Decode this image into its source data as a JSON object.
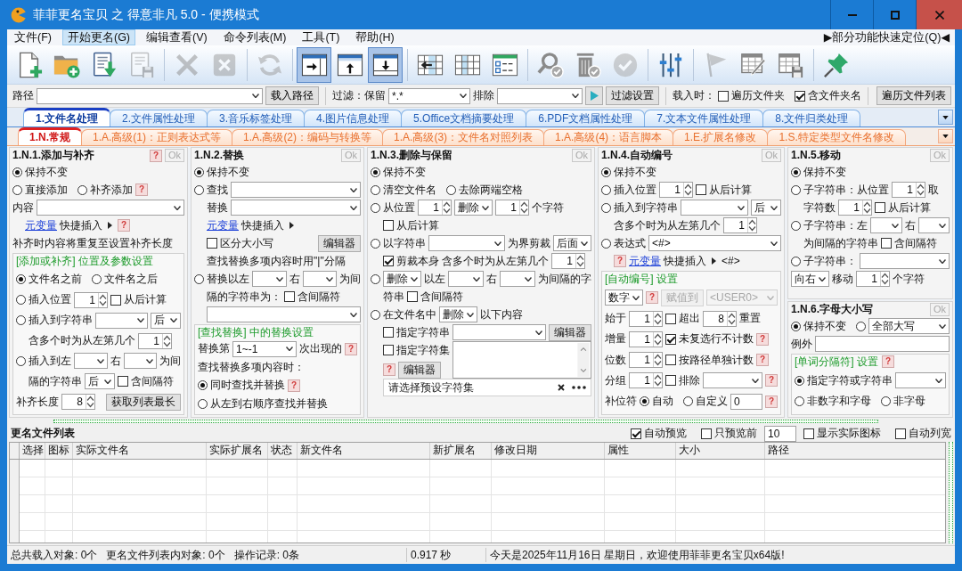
{
  "window": {
    "title": "菲菲更名宝贝 之 得意非凡 5.0 - 便携模式"
  },
  "menu": {
    "items": [
      {
        "label": "文件(F)",
        "selected": false
      },
      {
        "label": "开始更名(G)",
        "selected": true
      },
      {
        "label": "编辑查看(V)",
        "selected": false
      },
      {
        "label": "命令列表(M)",
        "selected": false
      },
      {
        "label": "工具(T)",
        "selected": false
      },
      {
        "label": "帮助(H)",
        "selected": false
      }
    ],
    "quick_locate": "▶部分功能快速定位(Q)◀"
  },
  "toolbar": {
    "groups": [
      [
        {
          "kind": "newfile",
          "disabled": false
        },
        {
          "kind": "addfolder",
          "disabled": false
        },
        {
          "kind": "import",
          "disabled": false
        },
        {
          "kind": "save",
          "disabled": true
        }
      ],
      [
        {
          "kind": "delete",
          "disabled": true
        },
        {
          "kind": "remove",
          "disabled": true
        }
      ],
      [
        {
          "kind": "refresh",
          "disabled": true
        }
      ],
      [
        {
          "kind": "viewright",
          "disabled": false,
          "selected": true
        },
        {
          "kind": "viewup",
          "disabled": false,
          "selected": false
        },
        {
          "kind": "viewdown",
          "disabled": false,
          "selected": true
        }
      ],
      [
        {
          "kind": "gridleft",
          "disabled": false
        },
        {
          "kind": "grid",
          "disabled": false
        },
        {
          "kind": "checklist",
          "disabled": false
        }
      ],
      [
        {
          "kind": "searchcheck",
          "disabled": false
        },
        {
          "kind": "trashcheck",
          "disabled": false
        },
        {
          "kind": "checkcircle",
          "disabled": true
        }
      ],
      [
        {
          "kind": "sliders",
          "disabled": false
        }
      ],
      [
        {
          "kind": "flag",
          "disabled": true
        },
        {
          "kind": "tableedit",
          "disabled": false
        },
        {
          "kind": "tablesave",
          "disabled": false
        }
      ],
      [
        {
          "kind": "pin",
          "disabled": false
        }
      ]
    ]
  },
  "path_bar": {
    "label": "路径",
    "load_button": "载入路径",
    "filter_label": "过滤：保留",
    "keep": "*.*",
    "exclude_label": "排除",
    "settings_button": "过滤设置",
    "on_load_label": "载入时：",
    "options": [
      {
        "label": "遍历文件夹",
        "checked": false
      },
      {
        "label": "含文件夹名",
        "checked": true
      }
    ],
    "list_button": "遍历文件列表"
  },
  "tabs": [
    {
      "label": "1.文件名处理",
      "selected": true
    },
    {
      "label": "2.文件属性处理",
      "selected": false
    },
    {
      "label": "3.音乐标签处理",
      "selected": false
    },
    {
      "label": "4.图片信息处理",
      "selected": false
    },
    {
      "label": "5.Office文档摘要处理",
      "selected": false
    },
    {
      "label": "6.PDF文档属性处理",
      "selected": false
    },
    {
      "label": "7.文本文件属性处理",
      "selected": false
    },
    {
      "label": "8.文件归类处理",
      "selected": false
    }
  ],
  "subtabs": [
    {
      "label": "1.N.常规",
      "selected": true
    },
    {
      "label": "1.A.高级(1)：正则表达式等",
      "selected": false
    },
    {
      "label": "1.A.高级(2)：编码与转换等",
      "selected": false
    },
    {
      "label": "1.A.高级(3)：文件名对照列表",
      "selected": false
    },
    {
      "label": "1.A.高级(4)：语言脚本",
      "selected": false
    },
    {
      "label": "1.E.扩展名修改",
      "selected": false
    },
    {
      "label": "1.S.特定类型文件名修改",
      "selected": false
    }
  ],
  "panels": [
    {
      "sections": [
        {
          "title": "1.N.1.添加与补齐",
          "help": "?",
          "ok": {
            "label": "Ok",
            "disabled": true
          },
          "rows": [
            {
              "kind": "row",
              "items": [
                {
                  "kind": "radio",
                  "label": "保持不变",
                  "selected": true
                }
              ]
            },
            {
              "kind": "row",
              "items": [
                {
                  "kind": "radio",
                  "label": "直接添加",
                  "selected": false
                },
                {
                  "kind": "radio",
                  "label": "补齐添加",
                  "selected": false
                },
                {
                  "kind": "help",
                  "label": "?"
                }
              ]
            },
            {
              "kind": "row",
              "items": [
                {
                  "kind": "text",
                  "text": "内容"
                },
                {
                  "kind": "combo",
                  "disabled": false
                }
              ],
              "children": [
                {
                  "kind": "row",
                  "items": [
                    {
                      "kind": "link",
                      "label": "元变量"
                    },
                    {
                      "kind": "text",
                      "text": "快捷插入"
                    },
                    {
                      "kind": "arrow"
                    },
                    {
                      "kind": "help",
                      "label": "?"
                    }
                  ]
                }
              ]
            },
            {
              "kind": "row",
              "items": [
                {
                  "kind": "text",
                  "text": "补齐时内容将重复至设置补齐长度"
                }
              ]
            },
            {
              "kind": "group",
              "title": "[添加或补齐] 位置及参数设置",
              "rows": [
                {
                  "kind": "row",
                  "items": [
                    {
                      "kind": "radio",
                      "label": "文件名之前",
                      "selected": true
                    },
                    {
                      "kind": "radio",
                      "label": "文件名之后",
                      "selected": false
                    }
                  ]
                },
                {
                  "kind": "row",
                  "items": [
                    {
                      "kind": "radio",
                      "label": "插入位置",
                      "selected": false
                    },
                    {
                      "kind": "spin",
                      "value": "1"
                    },
                    {
                      "kind": "check",
                      "label": "从后计算",
                      "checked": false
                    }
                  ]
                },
                {
                  "kind": "row",
                  "items": [
                    {
                      "kind": "radio",
                      "label": "插入到字符串",
                      "selected": false
                    },
                    {
                      "kind": "combo",
                      "disabled": false
                    },
                    {
                      "kind": "choice",
                      "value": "后",
                      "disabled": false
                    }
                  ],
                  "children": [
                    {
                      "kind": "row",
                      "items": [
                        {
                          "kind": "text",
                          "text": "含多个时为从左第几个"
                        },
                        {
                          "kind": "spin",
                          "value": "1"
                        }
                      ]
                    }
                  ]
                },
                {
                  "kind": "row",
                  "items": [
                    {
                      "kind": "radio",
                      "label": "插入到左",
                      "selected": false
                    },
                    {
                      "kind": "combo",
                      "disabled": false
                    },
                    {
                      "kind": "text",
                      "text": "右"
                    },
                    {
                      "kind": "combo",
                      "disabled": false
                    },
                    {
                      "kind": "text",
                      "text": "为间"
                    }
                  ],
                  "children": [
                    {
                      "kind": "row",
                      "items": [
                        {
                          "kind": "text",
                          "text": "隔的字符串"
                        },
                        {
                          "kind": "choice",
                          "value": "后",
                          "disabled": false
                        },
                        {
                          "kind": "check",
                          "label": "含间隔符",
                          "checked": false
                        }
                      ]
                    }
                  ]
                },
                {
                  "kind": "row",
                  "items": [
                    {
                      "kind": "text",
                      "text": "补齐长度"
                    },
                    {
                      "kind": "spin",
                      "value": "8"
                    },
                    {
                      "kind": "button",
                      "label": "获取列表最长",
                      "disabled": false
                    }
                  ]
                }
              ]
            }
          ]
        }
      ]
    },
    {
      "sections": [
        {
          "title": "1.N.2.替换",
          "ok": {
            "label": "Ok",
            "disabled": true
          },
          "rows": [
            {
              "kind": "row",
              "items": [
                {
                  "kind": "radio",
                  "label": "保持不变",
                  "selected": true
                }
              ]
            },
            {
              "kind": "row",
              "items": [
                {
                  "kind": "radio",
                  "label": "查找",
                  "selected": false
                },
                {
                  "kind": "combo",
                  "disabled": false
                }
              ],
              "children": [
                {
                  "kind": "row",
                  "items": [
                    {
                      "kind": "text",
                      "text": "替换"
                    },
                    {
                      "kind": "combo",
                      "disabled": false
                    }
                  ]
                },
                {
                  "kind": "row",
                  "items": [
                    {
                      "kind": "link",
                      "label": "元变量"
                    },
                    {
                      "kind": "text",
                      "text": "快捷插入"
                    },
                    {
                      "kind": "arrow"
                    }
                  ]
                },
                {
                  "kind": "row",
                  "items": [
                    {
                      "kind": "check",
                      "label": "区分大小写",
                      "checked": false
                    },
                    {
                      "kind": "button",
                      "label": "编辑器",
                      "disabled": false
                    }
                  ]
                },
                {
                  "kind": "row",
                  "items": [
                    {
                      "kind": "text",
                      "text": "查找替换多项内容时用\"|\"分隔"
                    }
                  ]
                }
              ]
            },
            {
              "kind": "row",
              "items": [
                {
                  "kind": "radio",
                  "label": "替换以左",
                  "selected": false
                },
                {
                  "kind": "combo",
                  "disabled": false
                },
                {
                  "kind": "text",
                  "text": "右"
                },
                {
                  "kind": "combo",
                  "disabled": false
                },
                {
                  "kind": "text",
                  "text": "为间"
                }
              ],
              "children": [
                {
                  "kind": "row",
                  "items": [
                    {
                      "kind": "text",
                      "text": "隔的字符串为："
                    },
                    {
                      "kind": "check",
                      "label": "含间隔符",
                      "checked": false
                    }
                  ]
                },
                {
                  "kind": "row",
                  "items": [
                    {
                      "kind": "combo",
                      "disabled": false
                    }
                  ]
                }
              ]
            },
            {
              "kind": "group",
              "title": "[查找替换] 中的替换设置",
              "rows": [
                {
                  "kind": "row",
                  "items": [
                    {
                      "kind": "text",
                      "text": "替换第"
                    },
                    {
                      "kind": "combo",
                      "value": "1~-1",
                      "disabled": false
                    },
                    {
                      "kind": "text",
                      "text": "次出现的"
                    },
                    {
                      "kind": "help",
                      "label": "?"
                    }
                  ]
                },
                {
                  "kind": "row",
                  "items": [
                    {
                      "kind": "text",
                      "text": "查找替换多项内容时："
                    }
                  ]
                },
                {
                  "kind": "row",
                  "items": [
                    {
                      "kind": "radio",
                      "label": "同时查找并替换",
                      "selected": true
                    },
                    {
                      "kind": "help",
                      "label": "?"
                    }
                  ]
                },
                {
                  "kind": "row",
                  "items": [
                    {
                      "kind": "radio",
                      "label": "从左到右顺序查找并替换",
                      "selected": false
                    }
                  ]
                }
              ]
            }
          ]
        }
      ]
    },
    {
      "sections": [
        {
          "title": "1.N.3.删除与保留",
          "ok": {
            "label": "Ok",
            "disabled": true
          },
          "rows": [
            {
              "kind": "row",
              "items": [
                {
                  "kind": "radio",
                  "label": "保持不变",
                  "selected": true
                }
              ]
            },
            {
              "kind": "row",
              "items": [
                {
                  "kind": "radio",
                  "label": "清空文件名",
                  "selected": false
                },
                {
                  "kind": "radio",
                  "label": "去除两端空格",
                  "selected": false
                }
              ]
            },
            {
              "kind": "row",
              "items": [
                {
                  "kind": "radio",
                  "label": "从位置",
                  "selected": false
                },
                {
                  "kind": "spin",
                  "value": "1"
                },
                {
                  "kind": "choice",
                  "value": "删除",
                  "disabled": false
                },
                {
                  "kind": "spin",
                  "value": "1"
                },
                {
                  "kind": "text",
                  "text": "个字符"
                }
              ],
              "children": [
                {
                  "kind": "row",
                  "items": [
                    {
                      "kind": "check",
                      "label": "从后计算",
                      "checked": false
                    }
                  ]
                }
              ]
            },
            {
              "kind": "row",
              "items": [
                {
                  "kind": "radio",
                  "label": "以字符串",
                  "selected": false
                },
                {
                  "kind": "combo",
                  "disabled": false
                },
                {
                  "kind": "text",
                  "text": "为界剪裁"
                },
                {
                  "kind": "choice",
                  "value": "后面",
                  "disabled": false
                }
              ],
              "children": [
                {
                  "kind": "row",
                  "items": [
                    {
                      "kind": "check",
                      "label": "剪裁本身",
                      "checked": true
                    },
                    {
                      "kind": "text",
                      "text": "含多个时为从左第几个"
                    },
                    {
                      "kind": "spin",
                      "value": "1"
                    }
                  ]
                }
              ]
            },
            {
              "kind": "row",
              "items": [
                {
                  "kind": "radio",
                  "selected": false
                },
                {
                  "kind": "choice",
                  "value": "删除",
                  "disabled": false
                },
                {
                  "kind": "text",
                  "text": "以左"
                },
                {
                  "kind": "combo",
                  "disabled": false
                },
                {
                  "kind": "text",
                  "text": "右"
                },
                {
                  "kind": "combo",
                  "disabled": false
                },
                {
                  "kind": "text",
                  "text": "为间隔的字"
                }
              ],
              "children": [
                {
                  "kind": "row",
                  "items": [
                    {
                      "kind": "text",
                      "text": "符串"
                    },
                    {
                      "kind": "check",
                      "label": "含间隔符",
                      "checked": false
                    }
                  ]
                }
              ]
            },
            {
              "kind": "row",
              "items": [
                {
                  "kind": "radio",
                  "label": "在文件名中",
                  "selected": false
                },
                {
                  "kind": "choice",
                  "value": "删除",
                  "disabled": false
                },
                {
                  "kind": "text",
                  "text": "以下内容"
                }
              ],
              "children": [
                {
                  "kind": "row",
                  "items": [
                    {
                      "kind": "check",
                      "label": "指定字符串",
                      "checked": false
                    },
                    {
                      "kind": "combo",
                      "disabled": false
                    },
                    {
                      "kind": "button",
                      "label": "编辑器",
                      "disabled": false
                    }
                  ]
                },
                {
                  "kind": "row",
                  "items": [
                    {
                      "kind": "stack",
                      "rows": [
                        {
                          "items": [
                            {
                              "kind": "check",
                              "label": "指定字符集",
                              "checked": false
                            }
                          ]
                        },
                        {
                          "items": [
                            {
                              "kind": "help",
                              "label": "?"
                            },
                            {
                              "kind": "button",
                              "label": "编辑器",
                              "disabled": false
                            }
                          ]
                        }
                      ]
                    },
                    {
                      "kind": "memo"
                    }
                  ]
                },
                {
                  "kind": "row",
                  "items": [
                    {
                      "kind": "preset",
                      "placeholder": "请选择预设字符集"
                    }
                  ]
                }
              ]
            }
          ]
        }
      ]
    },
    {
      "sections": [
        {
          "title": "1.N.4.自动编号",
          "ok": {
            "label": "Ok",
            "disabled": true
          },
          "rows": [
            {
              "kind": "row",
              "items": [
                {
                  "kind": "radio",
                  "label": "保持不变",
                  "selected": true
                }
              ]
            },
            {
              "kind": "row",
              "items": [
                {
                  "kind": "radio",
                  "label": "插入位置",
                  "selected": false
                },
                {
                  "kind": "spin",
                  "value": "1"
                },
                {
                  "kind": "check",
                  "label": "从后计算",
                  "checked": false
                }
              ]
            },
            {
              "kind": "row",
              "items": [
                {
                  "kind": "radio",
                  "label": "插入到字符串",
                  "selected": false
                },
                {
                  "kind": "combo",
                  "disabled": false
                },
                {
                  "kind": "choice",
                  "value": "后",
                  "disabled": false
                }
              ],
              "children": [
                {
                  "kind": "row",
                  "items": [
                    {
                      "kind": "text",
                      "text": "含多个时为从左第几个"
                    },
                    {
                      "kind": "spin",
                      "value": "1"
                    }
                  ]
                }
              ]
            },
            {
              "kind": "row",
              "items": [
                {
                  "kind": "radio",
                  "label": "表达式",
                  "selected": false
                },
                {
                  "kind": "combo",
                  "value": "<#>",
                  "disabled": false
                }
              ],
              "children": [
                {
                  "kind": "row",
                  "items": [
                    {
                      "kind": "help",
                      "label": "?"
                    },
                    {
                      "kind": "link",
                      "label": "元变量"
                    },
                    {
                      "kind": "text",
                      "text": "快捷插入"
                    },
                    {
                      "kind": "arrow"
                    },
                    {
                      "kind": "text",
                      "text": "<#>"
                    }
                  ]
                }
              ]
            },
            {
              "kind": "group",
              "title": "[自动编号] 设置",
              "rows": [
                {
                  "kind": "row",
                  "items": [
                    {
                      "kind": "choice",
                      "value": "数字",
                      "disabled": false
                    },
                    {
                      "kind": "help",
                      "label": "?"
                    },
                    {
                      "kind": "button",
                      "label": "赋值到",
                      "disabled": true
                    },
                    {
                      "kind": "combo",
                      "value": "<USER0>",
                      "disabled": true
                    }
                  ]
                },
                {
                  "kind": "row",
                  "items": [
                    {
                      "kind": "text",
                      "text": "始于"
                    },
                    {
                      "kind": "spin",
                      "value": "1"
                    },
                    {
                      "kind": "check",
                      "label": "超出",
                      "checked": false
                    },
                    {
                      "kind": "spin",
                      "value": "8"
                    },
                    {
                      "kind": "text",
                      "text": "重置"
                    }
                  ]
                },
                {
                  "kind": "row",
                  "items": [
                    {
                      "kind": "text",
                      "text": "增量"
                    },
                    {
                      "kind": "spin",
                      "value": "1"
                    },
                    {
                      "kind": "check",
                      "label": "未复选行不计数",
                      "checked": true
                    },
                    {
                      "kind": "help",
                      "label": "?"
                    }
                  ]
                },
                {
                  "kind": "row",
                  "items": [
                    {
                      "kind": "text",
                      "text": "位数"
                    },
                    {
                      "kind": "spin",
                      "value": "1"
                    },
                    {
                      "kind": "check",
                      "label": "按路径单独计数",
                      "checked": false
                    },
                    {
                      "kind": "help",
                      "label": "?"
                    }
                  ]
                },
                {
                  "kind": "row",
                  "items": [
                    {
                      "kind": "text",
                      "text": "分组"
                    },
                    {
                      "kind": "spin",
                      "value": "1"
                    },
                    {
                      "kind": "check",
                      "label": "排除",
                      "checked": false
                    },
                    {
                      "kind": "combo",
                      "disabled": false
                    },
                    {
                      "kind": "help",
                      "label": "?"
                    }
                  ]
                },
                {
                  "kind": "row",
                  "items": [
                    {
                      "kind": "text",
                      "text": "补位符"
                    },
                    {
                      "kind": "radio",
                      "label": "自动",
                      "selected": true
                    },
                    {
                      "kind": "radio",
                      "label": "自定义",
                      "selected": false
                    },
                    {
                      "kind": "input",
                      "value": "0"
                    },
                    {
                      "kind": "help",
                      "label": "?"
                    }
                  ]
                }
              ]
            }
          ]
        }
      ]
    },
    {
      "sections": [
        {
          "title": "1.N.5.移动",
          "ok": {
            "label": "Ok",
            "disabled": true
          },
          "rows": [
            {
              "kind": "row",
              "items": [
                {
                  "kind": "radio",
                  "label": "保持不变",
                  "selected": true
                }
              ]
            },
            {
              "kind": "row",
              "items": [
                {
                  "kind": "radio",
                  "label": "子字符串：从位置",
                  "selected": false
                },
                {
                  "kind": "spin",
                  "value": "1"
                },
                {
                  "kind": "text",
                  "text": "取"
                }
              ],
              "children": [
                {
                  "kind": "row",
                  "items": [
                    {
                      "kind": "text",
                      "text": "字符数"
                    },
                    {
                      "kind": "spin",
                      "value": "1"
                    },
                    {
                      "kind": "check",
                      "label": "从后计算",
                      "checked": false
                    }
                  ]
                }
              ]
            },
            {
              "kind": "row",
              "items": [
                {
                  "kind": "radio",
                  "label": "子字符串：左",
                  "selected": false
                },
                {
                  "kind": "combo",
                  "disabled": false
                },
                {
                  "kind": "text",
                  "text": "右"
                },
                {
                  "kind": "combo",
                  "disabled": false
                }
              ],
              "children": [
                {
                  "kind": "row",
                  "items": [
                    {
                      "kind": "text",
                      "text": "为间隔的字符串"
                    },
                    {
                      "kind": "check",
                      "label": "含间隔符",
                      "checked": false
                    }
                  ]
                }
              ]
            },
            {
              "kind": "row",
              "items": [
                {
                  "kind": "radio",
                  "label": "子字符串：",
                  "selected": false
                },
                {
                  "kind": "combo",
                  "disabled": false
                }
              ]
            },
            {
              "kind": "row",
              "items": [
                {
                  "kind": "choice",
                  "value": "向右",
                  "disabled": false
                },
                {
                  "kind": "text",
                  "text": "移动"
                },
                {
                  "kind": "spin",
                  "value": "1"
                },
                {
                  "kind": "text",
                  "text": "个字符"
                }
              ]
            }
          ]
        },
        {
          "title": "1.N.6.字母大小写",
          "ok": {
            "label": "Ok",
            "disabled": true
          },
          "rows": [
            {
              "kind": "row",
              "items": [
                {
                  "kind": "radio",
                  "label": "保持不变",
                  "selected": true
                },
                {
                  "kind": "radio",
                  "selected": false
                },
                {
                  "kind": "combo",
                  "value": "全部大写",
                  "disabled": false
                }
              ]
            },
            {
              "kind": "row",
              "items": [
                {
                  "kind": "text",
                  "text": "例外"
                },
                {
                  "kind": "input"
                }
              ]
            },
            {
              "kind": "group",
              "title": "[单词分隔符] 设置",
              "help": "?",
              "rows": [
                {
                  "kind": "row",
                  "items": [
                    {
                      "kind": "radio",
                      "label": "指定字符或字符串",
                      "selected": true
                    },
                    {
                      "kind": "combo",
                      "disabled": false
                    }
                  ]
                },
                {
                  "kind": "row",
                  "items": [
                    {
                      "kind": "radio",
                      "label": "非数字和字母",
                      "selected": false
                    },
                    {
                      "kind": "radio",
                      "label": "非字母",
                      "selected": false
                    }
                  ]
                }
              ]
            }
          ]
        }
      ]
    }
  ],
  "file_list": {
    "title": "更名文件列表",
    "options": [
      {
        "kind": "check",
        "label": "自动预览",
        "checked": true
      },
      {
        "kind": "check",
        "label": "只预览前",
        "checked": false
      },
      {
        "kind": "input",
        "value": "10"
      },
      {
        "kind": "check",
        "label": "显示实际图标",
        "checked": false
      },
      {
        "kind": "check",
        "label": "自动列宽",
        "checked": false
      }
    ],
    "columns": [
      "选择",
      "图标",
      "实际文件名",
      "实际扩展名",
      "状态",
      "新文件名",
      "新扩展名",
      "修改日期",
      "属性",
      "大小",
      "路径"
    ]
  },
  "status_bar": {
    "counts": [
      "总共载入对象: 0个",
      "更名文件列表内对象: 0个",
      "操作记录: 0条"
    ],
    "elapsed": "0.917 秒",
    "message": "今天是2025年11月16日 星期日，欢迎使用菲菲更名宝贝x64版!"
  }
}
